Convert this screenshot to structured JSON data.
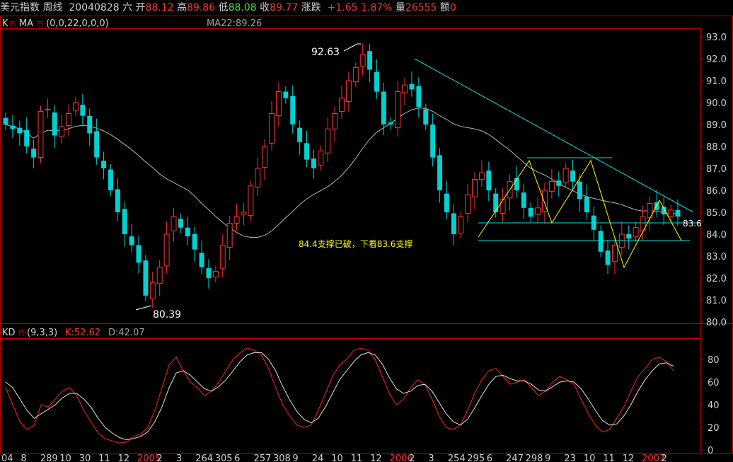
{
  "header": {
    "name": "美元指数",
    "period": "周线",
    "date": "20040828",
    "weekday": "六",
    "open_label": "开",
    "open": "88.12",
    "high_label": "高",
    "high": "89.86",
    "low_label": "低",
    "low": "88.08",
    "close_label": "收",
    "close": "89.77",
    "change_label": "涨跌",
    "change": "+1.65",
    "change_pct": "1.87%",
    "volume_label": "量",
    "volume": "26555",
    "amount_label": "额",
    "amount": "0"
  },
  "main_panel": {
    "indicator": "K",
    "ma_label": "MA",
    "ma_params": "(0,0,22,0,0,0)",
    "ma_value": "MA22:89.26",
    "peak_label": "92.63",
    "trough_label": "80.39",
    "annotation": "84.4支撑已破，下看83.6支撑",
    "level_label": "83.6"
  },
  "kd_panel": {
    "name": "KD",
    "params": "(9,3,3)",
    "k_label": "K:52.62",
    "d_label": "D:42.07"
  },
  "colors": {
    "up": "#ff3232",
    "down": "#00d2d2",
    "ma": "#b4b4b4",
    "trendline": "#00e0e0",
    "pattern": "#ffff00",
    "k_line": "#ff2020",
    "d_line": "#e0e0e0",
    "frame": "#c00000"
  },
  "chart_data": [
    {
      "type": "candlestick",
      "title": "美元指数 周线",
      "ylim": [
        80.0,
        93.0
      ],
      "y_ticks": [
        80.0,
        81.0,
        82.0,
        83.0,
        84.0,
        85.0,
        86.0,
        87.0,
        88.0,
        89.0,
        90.0,
        91.0,
        92.0,
        93.0
      ],
      "x_tick_labels": [
        "04",
        "8",
        "289",
        "10",
        "30",
        "11",
        "12",
        "2005",
        "2",
        "3",
        "264",
        "305",
        "6",
        "257",
        "308",
        "9",
        "24",
        "10",
        "11",
        "12",
        "2006",
        "2",
        "3",
        "254",
        "295",
        "6",
        "247",
        "298",
        "9",
        "23",
        "10",
        "11",
        "12",
        "2007",
        "2"
      ],
      "close": [
        89.0,
        88.8,
        88.6,
        88.0,
        87.5,
        89.6,
        89.7,
        88.5,
        88.9,
        89.5,
        90.0,
        89.4,
        88.6,
        87.5,
        87.0,
        86.0,
        85.0,
        84.0,
        83.5,
        82.7,
        81.2,
        81.8,
        82.5,
        84.0,
        84.8,
        84.3,
        83.9,
        83.3,
        82.5,
        82.0,
        82.3,
        83.5,
        84.5,
        84.8,
        85.0,
        86.2,
        87.0,
        88.0,
        89.5,
        90.5,
        90.2,
        89.0,
        88.2,
        87.4,
        87.0,
        87.8,
        88.8,
        89.5,
        90.2,
        91.0,
        91.6,
        92.2,
        91.5,
        90.5,
        89.0,
        89.0,
        90.5,
        90.8,
        90.6,
        89.8,
        89.0,
        87.5,
        86.0,
        85.0,
        84.0,
        84.8,
        85.8,
        86.5,
        86.8,
        86.0,
        85.0,
        85.6,
        86.4,
        86.0,
        85.2,
        84.8,
        85.2,
        86.0,
        86.4,
        86.2,
        87.0,
        86.4,
        85.6,
        85.0,
        84.2,
        83.2,
        82.6,
        83.5,
        84.0,
        83.8,
        84.3,
        84.8,
        85.4,
        85.1,
        84.9,
        85.1,
        84.8
      ],
      "ma_name": "MA22"
    },
    {
      "type": "line",
      "title": "KD(9,3,3)",
      "ylim": [
        0,
        100
      ],
      "y_ticks": [
        0,
        20,
        40,
        60,
        80
      ],
      "series": [
        {
          "name": "K",
          "values": [
            55,
            40,
            25,
            18,
            22,
            40,
            38,
            45,
            52,
            55,
            48,
            35,
            25,
            15,
            10,
            8,
            6,
            7,
            12,
            14,
            20,
            35,
            55,
            75,
            82,
            70,
            60,
            55,
            48,
            52,
            60,
            70,
            80,
            86,
            90,
            88,
            84,
            72,
            55,
            40,
            30,
            22,
            20,
            22,
            35,
            50,
            65,
            75,
            80,
            88,
            90,
            88,
            80,
            65,
            50,
            40,
            45,
            55,
            62,
            58,
            45,
            30,
            20,
            18,
            22,
            35,
            50,
            62,
            70,
            72,
            65,
            58,
            60,
            62,
            55,
            48,
            52,
            60,
            65,
            62,
            58,
            45,
            32,
            22,
            16,
            18,
            28,
            38,
            52,
            65,
            72,
            80,
            82,
            78,
            70
          ]
        },
        {
          "name": "D",
          "values": [
            60,
            55,
            45,
            35,
            28,
            32,
            36,
            40,
            46,
            50,
            50,
            45,
            38,
            28,
            20,
            15,
            11,
            9,
            10,
            12,
            16,
            25,
            38,
            55,
            68,
            70,
            66,
            60,
            54,
            52,
            56,
            62,
            70,
            78,
            84,
            86,
            86,
            80,
            70,
            56,
            44,
            34,
            27,
            24,
            28,
            38,
            50,
            62,
            70,
            78,
            84,
            86,
            84,
            76,
            64,
            54,
            50,
            52,
            57,
            58,
            52,
            42,
            32,
            25,
            22,
            27,
            37,
            48,
            58,
            65,
            66,
            63,
            61,
            61,
            58,
            53,
            52,
            56,
            60,
            61,
            60,
            54,
            45,
            35,
            26,
            22,
            23,
            30,
            40,
            52,
            62,
            70,
            76,
            77,
            74
          ]
        }
      ]
    }
  ]
}
